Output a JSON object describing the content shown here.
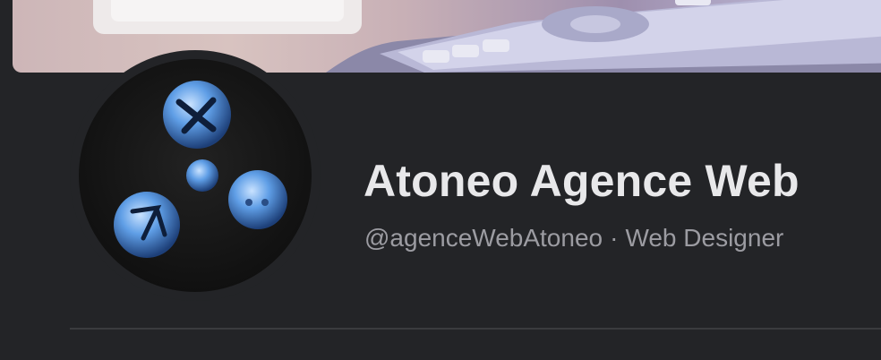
{
  "profile": {
    "name": "Atoneo Agence Web",
    "handle": "@agenceWebAtoneo",
    "separator": "·",
    "role": "Web Designer"
  }
}
